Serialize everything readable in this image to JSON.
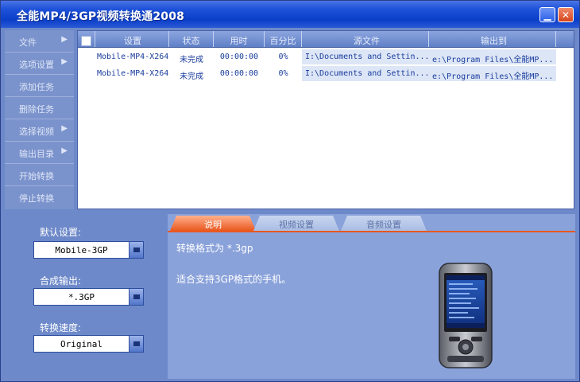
{
  "window": {
    "title": "全能MP4/3GP视频转换通2008",
    "minimize_glyph": "▁",
    "close_glyph": "✕"
  },
  "sidebar": {
    "items": [
      {
        "label": "文件",
        "has_arrow": true
      },
      {
        "label": "选项设置",
        "has_arrow": true
      },
      {
        "label": "添加任务",
        "has_arrow": false
      },
      {
        "label": "删除任务",
        "has_arrow": false
      },
      {
        "label": "选择视频",
        "has_arrow": true
      },
      {
        "label": "输出目录",
        "has_arrow": true
      },
      {
        "label": "开始转换",
        "has_arrow": false
      },
      {
        "label": "停止转换",
        "has_arrow": false
      }
    ]
  },
  "task_list": {
    "columns": [
      "设置",
      "状态",
      "用时",
      "百分比",
      "源文件",
      "输出到"
    ],
    "rows": [
      {
        "preset": "Mobile-MP4-X264",
        "status": "未完成",
        "time": "00:00:00",
        "percent": "0%",
        "source": "I:\\Documents and Settin...",
        "output": "e:\\Program Files\\全能MP..."
      },
      {
        "preset": "Mobile-MP4-X264",
        "status": "未完成",
        "time": "00:00:00",
        "percent": "0%",
        "source": "I:\\Documents and Settin...",
        "output": "e:\\Program Files\\全能MP..."
      }
    ]
  },
  "settings": {
    "default_label": "默认设置:",
    "default_value": "Mobile-3GP",
    "output_label": "合成输出:",
    "output_value": "*.3GP",
    "speed_label": "转换速度:",
    "speed_value": "Original"
  },
  "tabs": {
    "items": [
      "说明",
      "视频设置",
      "音频设置"
    ],
    "active": "说明"
  },
  "description": {
    "line1": "转换格式为 *.3gp",
    "line2": "适合支持3GP格式的手机。"
  },
  "colors": {
    "accent_tab": "#e9581f",
    "list_text": "#1a3d9e",
    "panel_bg": "#8aa2da"
  }
}
